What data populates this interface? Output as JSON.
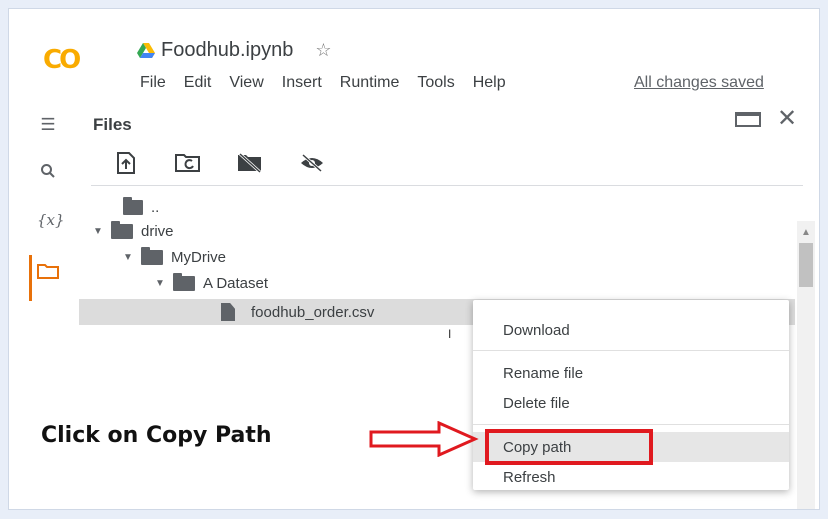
{
  "notebook": {
    "title": "Foodhub.ipynb",
    "logo_text": "CO"
  },
  "menu": [
    "File",
    "Edit",
    "View",
    "Insert",
    "Runtime",
    "Tools",
    "Help"
  ],
  "status": {
    "saved": "All changes saved"
  },
  "sidebar": {
    "title": "Files",
    "variables_label": "{x}"
  },
  "tree": {
    "parent": "..",
    "drive": "drive",
    "mydrive": "MyDrive",
    "dataset": "A Dataset",
    "file": "foodhub_order.csv"
  },
  "context_menu": {
    "download": "Download",
    "rename": "Rename file",
    "delete": "Delete file",
    "copy_path": "Copy path",
    "refresh": "Refresh"
  },
  "annotation": {
    "text": "Click on Copy Path"
  },
  "colors": {
    "accent_orange": "#e8710a",
    "logo_yellow": "#f9ab00",
    "highlight_red": "#e0191f"
  }
}
